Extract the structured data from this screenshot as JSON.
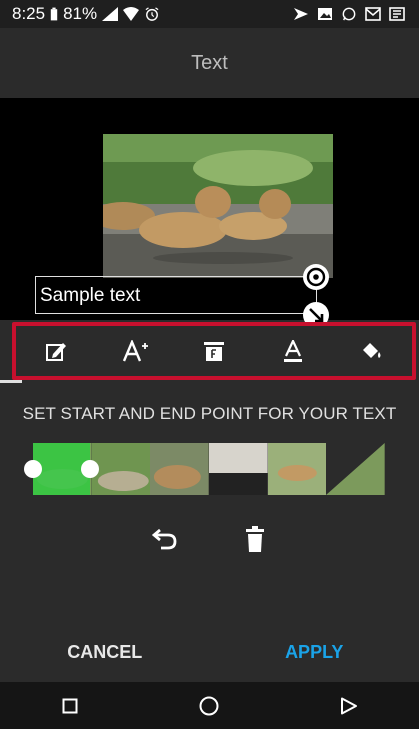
{
  "status_bar": {
    "time": "8:25",
    "battery": "81%",
    "icons": [
      "battery-icon",
      "signal-icon",
      "wifi-icon",
      "alarm-icon",
      "cast-icon",
      "gallery-icon",
      "whatsapp-icon",
      "gmail-icon",
      "news-icon"
    ]
  },
  "header": {
    "title": "Text"
  },
  "preview": {
    "text_overlay": "Sample text"
  },
  "toolbar": {
    "tools": [
      "edit-text-icon",
      "font-size-icon",
      "font-style-icon",
      "text-color-icon",
      "fill-color-icon"
    ]
  },
  "timeline": {
    "label": "SET START AND END POINT FOR YOUR TEXT"
  },
  "actions": {
    "icons": [
      "undo-icon",
      "delete-icon"
    ]
  },
  "buttons": {
    "cancel": "CANCEL",
    "apply": "APPLY"
  },
  "nav_bar": {
    "icons": [
      "recents-icon",
      "home-icon",
      "back-icon"
    ]
  },
  "colors": {
    "accent": "#1aa3e8",
    "highlight": "#c8102e",
    "range": "#2ecc40"
  }
}
